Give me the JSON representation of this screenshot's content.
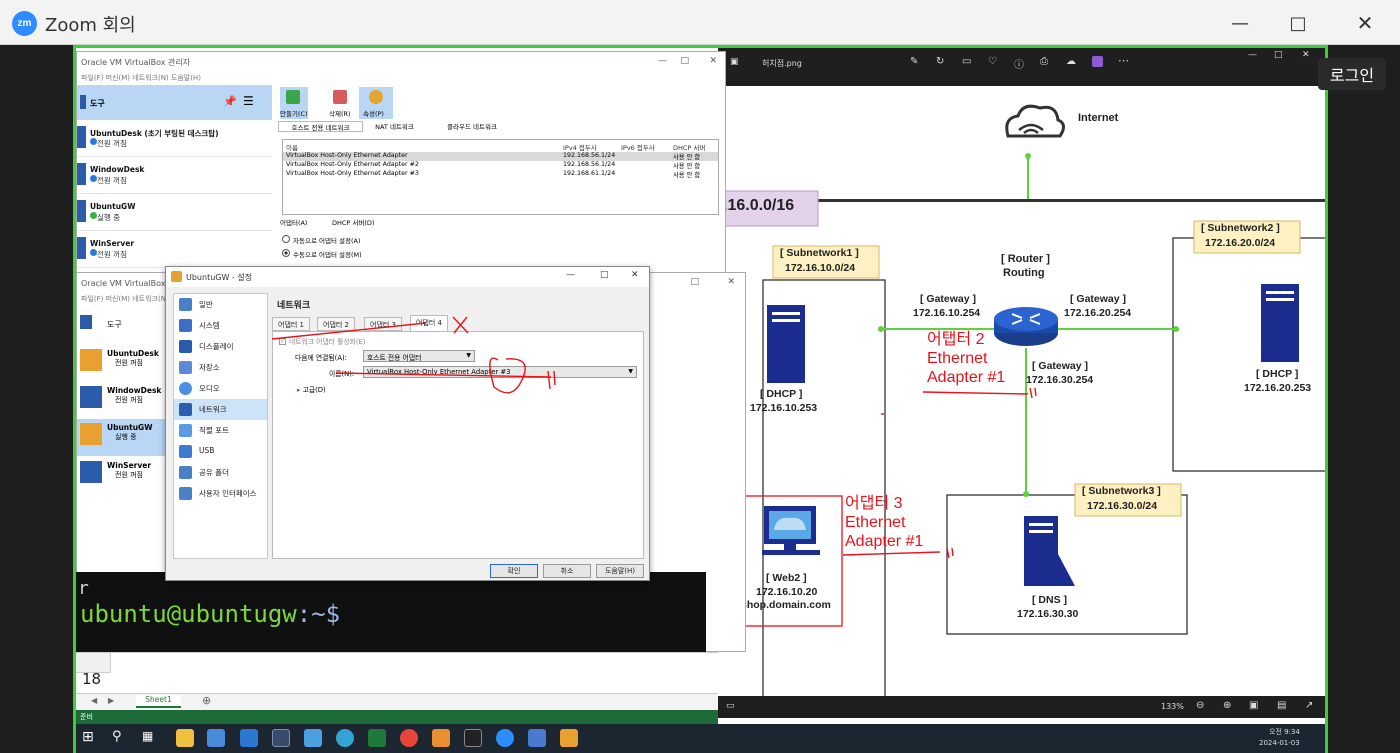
{
  "zoom": {
    "title": "Zoom 회의",
    "logo": "zm",
    "login_label": "로그인",
    "minimize_icon": "minimize-icon",
    "maximize_icon": "maximize-icon",
    "close_icon": "close-icon"
  },
  "viewer": {
    "filename": "허치점.png",
    "zoom_level": "133%",
    "diagram": {
      "internet_label": "Internet",
      "network_label": ".16.0.0/16",
      "router_label": "[ Router ]",
      "router_sub": "Routing",
      "subnet1_title": "[ Subnetwork1 ]",
      "subnet1_cidr": "172.16.10.0/24",
      "subnet2_title": "[ Subnetwork2 ]",
      "subnet2_cidr": "172.16.20.0/24",
      "subnet3_title": "[ Subnetwork3 ]",
      "subnet3_cidr": "172.16.30.0/24",
      "gw1_title": "[ Gateway ]",
      "gw1_ip": "172.16.10.254",
      "gw2_title": "[ Gateway ]",
      "gw2_ip": "172.16.20.254",
      "gw3_title": "[ Gateway ]",
      "gw3_ip": "172.16.30.254",
      "dhcp1_title": "[ DHCP ]",
      "dhcp1_ip": "172.16.10.253",
      "dhcp2_title": "[ DHCP ]",
      "dhcp2_ip": "172.16.20.253",
      "web_title": "[ Web2 ]",
      "web_ip": "172.16.10.20",
      "web_host": "shop.domain.com",
      "dns_title": "[ DNS ]",
      "dns_ip": "172.16.30.30",
      "annot1_l1": "어탭터 2",
      "annot1_l2": "Ethernet",
      "annot1_l3": "Adapter #1",
      "annot2_l1": "어댑터 3",
      "annot2_l2": "Ethernet",
      "annot2_l3": "Adapter #1"
    }
  },
  "vbox": {
    "title": "Oracle VM VirtualBox 관리자",
    "menu": "파일(F)  머신(M)  네트워크(N)  도움말(H)",
    "tools_label": "도구",
    "toolbar": {
      "create": "만들기(C)",
      "remove": "삭제(R)",
      "props": "속성(P)"
    },
    "net_tabs": [
      "호스트 전용 네트워크",
      "NAT 네트워크",
      "클라우드 네트워크"
    ],
    "net_headers": [
      "이름",
      "IPv4 접두사",
      "IPv6 접두사",
      "DHCP 서버"
    ],
    "net_rows": [
      [
        "VirtualBox Host-Only Ethernet Adapter",
        "192.168.56.1/24",
        "",
        "사용 안 함"
      ],
      [
        "VirtualBox Host-Only Ethernet Adapter #2",
        "192.168.56.1/24",
        "",
        "사용 안 함"
      ],
      [
        "VirtualBox Host-Only Ethernet Adapter #3",
        "192.168.61.1/24",
        "",
        "사용 안 함"
      ]
    ],
    "adapter_tabs": [
      "어댑터(A)",
      "DHCP 서버(D)"
    ],
    "radio_auto": "자동으로 어댑터 설정(A)",
    "radio_manual": "수동으로 어댑터 설정(M)",
    "vms": [
      {
        "name": "UbuntuDesk (초기 부팅된 데스크탑)",
        "state": "전원 꺼짐"
      },
      {
        "name": "WindowDesk",
        "state": "전원 꺼짐"
      },
      {
        "name": "UbuntuGW",
        "state": "실행 중"
      },
      {
        "name": "WinServer",
        "state": "전원 꺼짐"
      }
    ],
    "vms2": [
      {
        "name": "UbuntuDesk",
        "state": "전원 꺼짐"
      },
      {
        "name": "WindowDesk",
        "state": "전원 꺼짐"
      },
      {
        "name": "UbuntuGW",
        "state": "실행 중"
      },
      {
        "name": "WinServer",
        "state": "전원 꺼짐"
      }
    ]
  },
  "settings": {
    "title": "UbuntuGW - 설정",
    "section": "네트워크",
    "nav": [
      "일반",
      "시스템",
      "디스플레이",
      "저장소",
      "오디오",
      "네트워크",
      "직렬 포트",
      "USB",
      "공유 폴더",
      "사용자 인터페이스"
    ],
    "adapter_tabs": [
      "어댑터 1",
      "어댑터 2",
      "어댑터 3",
      "어댑터 4"
    ],
    "enable_label": "네트워크 어댑터 활성화(E)",
    "attached_label": "다음에 연결됨(A):",
    "attached_value": "호스트 전용 어댑터",
    "name_label": "이름(N):",
    "name_value": "VirtualBox Host-Only Ethernet Adapter #3",
    "advanced_label": "고급(D)",
    "ok": "확인",
    "cancel": "취소",
    "help": "도움말(H)"
  },
  "terminal": {
    "line1": "r",
    "user_host": "ubuntu@ubuntugw",
    "path": ":~$"
  },
  "sheet": {
    "row_num": "18",
    "tab": "Sheet1",
    "status": "준비"
  },
  "taskbar": {
    "time": "오전 9:34",
    "date": "2024-01-03"
  }
}
